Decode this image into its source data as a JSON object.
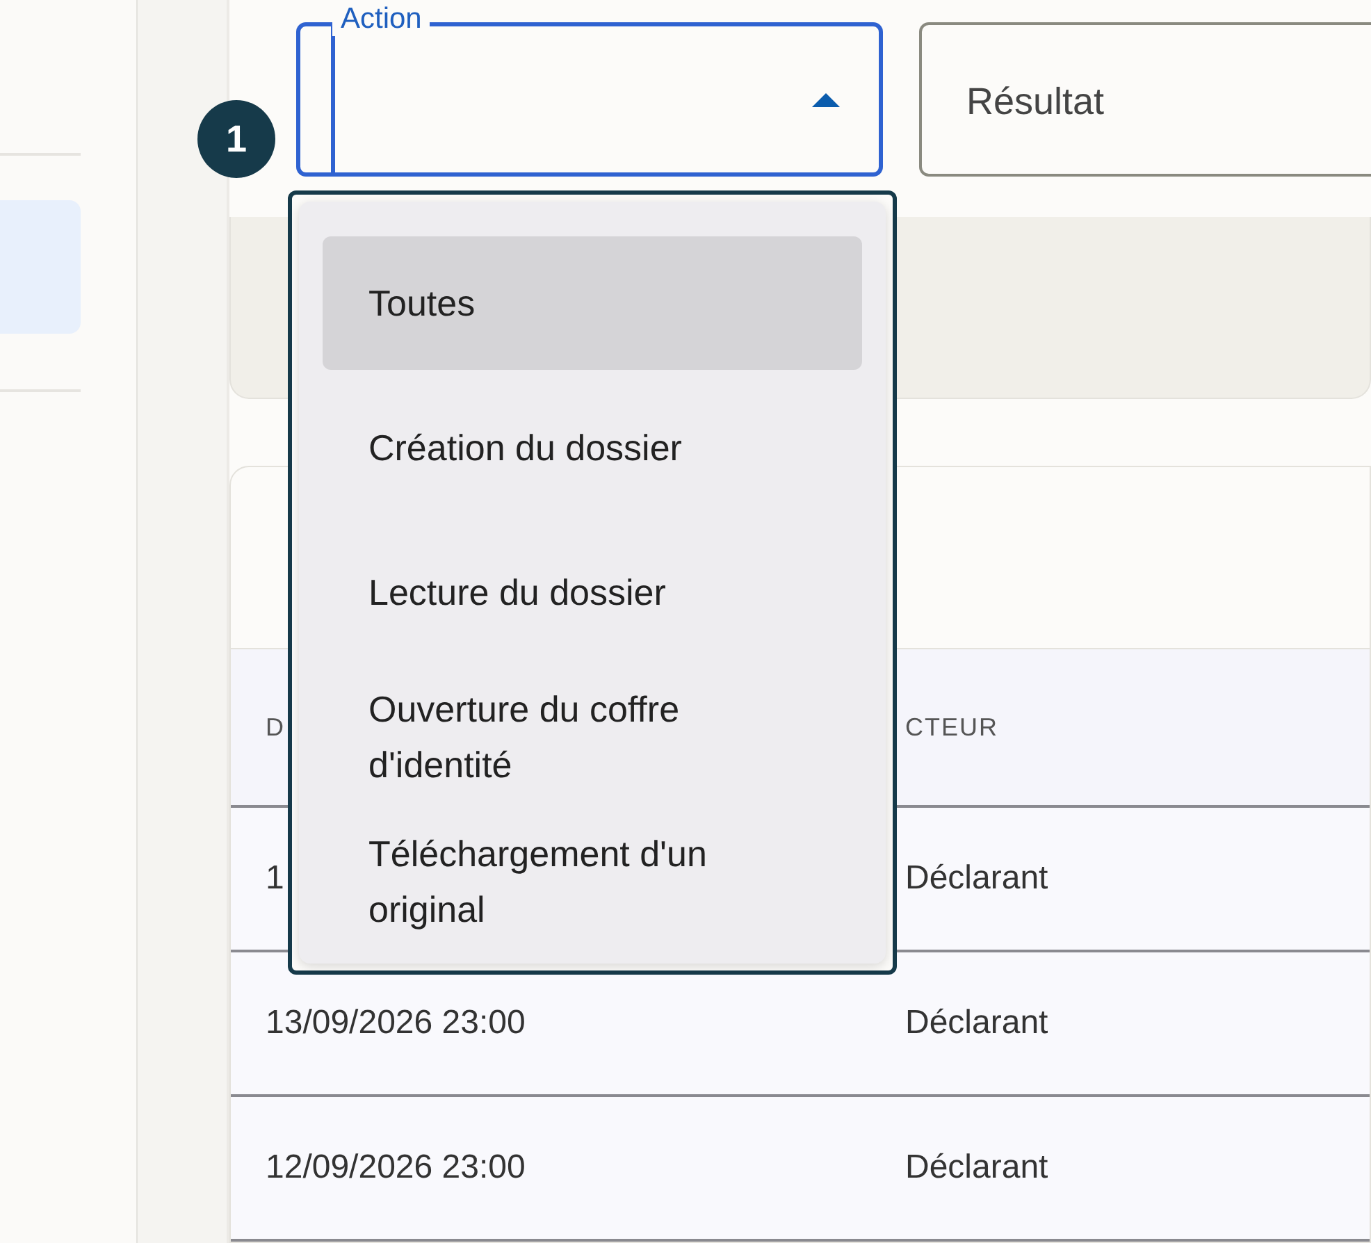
{
  "sidebar": {
    "items": [
      {
        "selected": true
      }
    ]
  },
  "step_badge": "1",
  "filters": [
    {
      "kind": "select",
      "label": "Action",
      "expanded": true,
      "focused": true
    },
    {
      "kind": "select",
      "placeholder": "Résultat",
      "expanded": false,
      "focused": false
    }
  ],
  "dropdown": {
    "options": [
      {
        "label": "Toutes",
        "selected": true
      },
      {
        "label": "Création du dossier",
        "selected": false
      },
      {
        "label": "Lecture du dossier",
        "selected": false
      },
      {
        "label": "Ouverture du coffre d'identité",
        "selected": false
      },
      {
        "label": "Téléchargement d'un original",
        "selected": false
      }
    ]
  },
  "table": {
    "columns": [
      "D",
      "CTEUR"
    ],
    "rows": [
      [
        "1",
        "Déclarant"
      ],
      [
        "13/09/2026 23:00",
        "Déclarant"
      ],
      [
        "12/09/2026 23:00",
        "Déclarant"
      ]
    ]
  }
}
